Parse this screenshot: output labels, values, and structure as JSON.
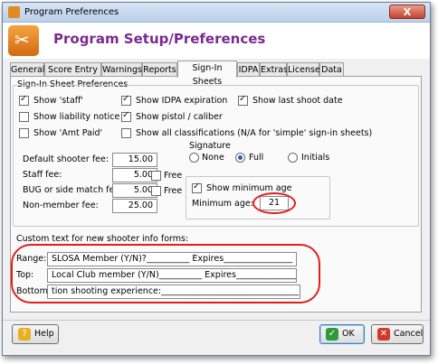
{
  "window": {
    "title": "Program Preferences",
    "close_glyph": "X"
  },
  "header": {
    "title": "Program Setup/Preferences",
    "icon": "tools-icon"
  },
  "tabs": [
    "General",
    "Score Entry",
    "Warnings",
    "Reports",
    "Sign-In Sheets",
    "IDPA",
    "Extras",
    "License",
    "Data"
  ],
  "active_tab": "Sign-In Sheets",
  "section_title": "Sign-In Sheet Preferences",
  "checkboxes": {
    "show_staff": {
      "label": "Show 'staff'",
      "checked": true
    },
    "show_liability": {
      "label": "Show liability notice",
      "checked": false
    },
    "show_amt_paid": {
      "label": "Show 'Amt Paid'",
      "checked": false
    },
    "show_idpa_exp": {
      "label": "Show IDPA expiration",
      "checked": true
    },
    "show_pistol": {
      "label": "Show pistol / caliber",
      "checked": true
    },
    "show_all_class": {
      "label": "Show all classifications (N/A for 'simple' sign-in sheets)",
      "checked": false
    },
    "show_last_shoot": {
      "label": "Show last shoot date",
      "checked": true
    }
  },
  "fees": {
    "default_label": "Default shooter fee:",
    "default_value": "15.00",
    "staff_label": "Staff fee:",
    "staff_value": "5.00",
    "bug_label": "BUG or side match fee:",
    "bug_value": "5.00",
    "nonmember_label": "Non-member fee:",
    "nonmember_value": "25.00",
    "free_label": "Free"
  },
  "signature": {
    "label": "Signature",
    "options": [
      "None",
      "Full",
      "Initials"
    ],
    "selected": "Full"
  },
  "min_age": {
    "checkbox_label": "Show minimum age",
    "checked": true,
    "label": "Minimum age:",
    "value": "21"
  },
  "custom_text": {
    "label": "Custom text for new shooter info forms:",
    "range_label": "Range:",
    "range_value": "SLOSA Member (Y/N)?__________ Expires________________",
    "top_label": "Top:",
    "top_value": "Local Club member (Y/N)__________ Expires______________",
    "bottom_label": "Bottom:",
    "bottom_value": "tion shooting experience:________________________________"
  },
  "buttons": {
    "help": "Help",
    "ok": "OK",
    "cancel": "Cancel"
  },
  "colors": {
    "header_title": "#7a2a8f",
    "annotation": "#e02020"
  }
}
